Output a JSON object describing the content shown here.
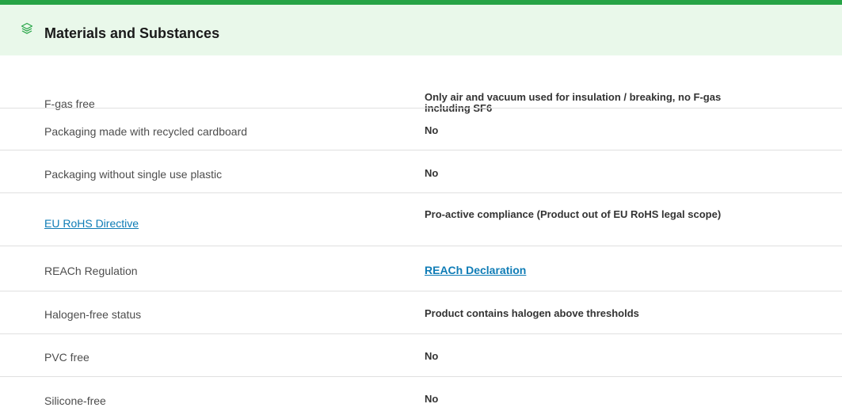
{
  "section": {
    "title": "Materials and Substances",
    "icon": "layers-icon",
    "accent_color": "#26a446",
    "header_bg": "#e9f8ea"
  },
  "rows": [
    {
      "label": "F-gas free",
      "value": "Only air and vacuum used for insulation / breaking, no F-gas including SF6"
    },
    {
      "label": "Packaging made with recycled cardboard",
      "value": "No"
    },
    {
      "label": "Packaging without single use plastic",
      "value": "No"
    },
    {
      "label": "EU RoHS Directive",
      "value": "Pro-active compliance (Product out of EU RoHS legal scope)"
    },
    {
      "label": "REACh Regulation",
      "value": "REACh Declaration"
    },
    {
      "label": "Halogen-free status",
      "value": "Product contains halogen above thresholds"
    },
    {
      "label": "PVC free",
      "value": "No"
    },
    {
      "label": "Silicone-free",
      "value": "No"
    }
  ],
  "link_color": "#0f7cb6"
}
